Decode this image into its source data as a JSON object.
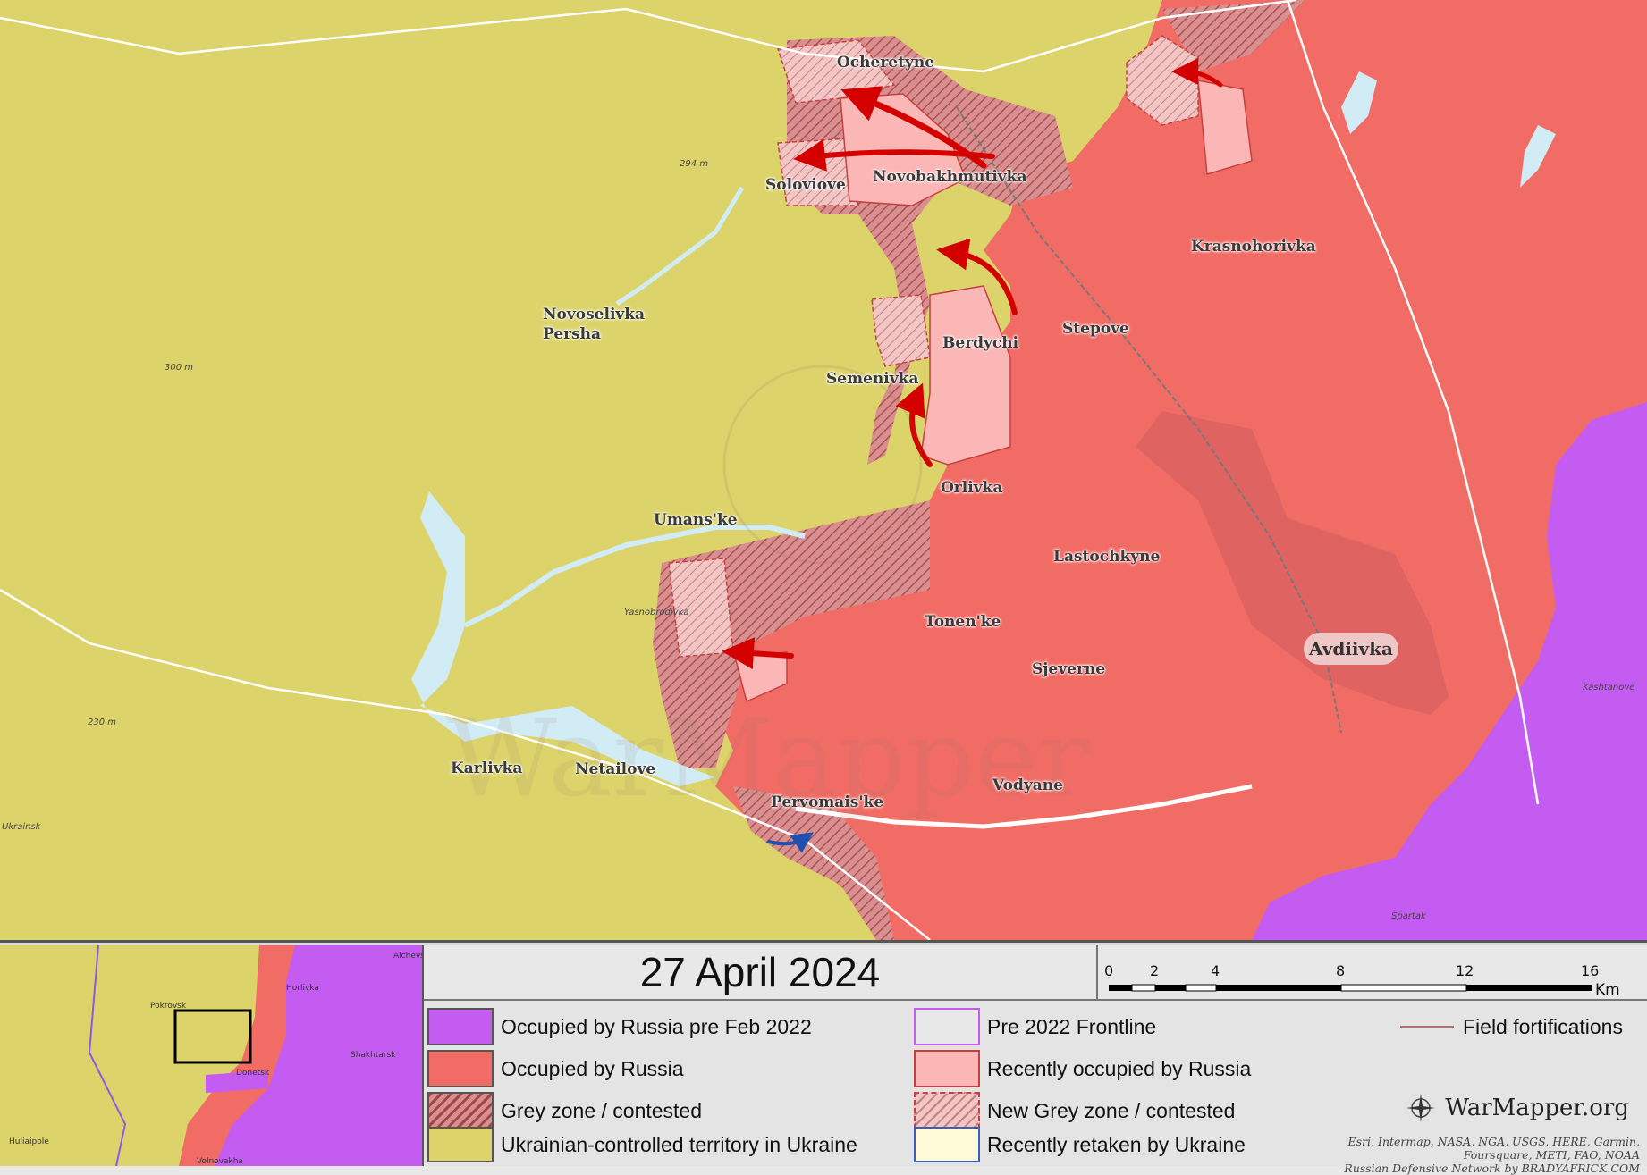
{
  "date": "27 April 2024",
  "scale_bar": {
    "ticks": [
      "0",
      "2",
      "4",
      "8",
      "12",
      "16"
    ],
    "unit": "Km"
  },
  "legend": {
    "occupied_pre2022": "Occupied by Russia pre Feb 2022",
    "occupied": "Occupied by Russia",
    "grey_zone": "Grey zone / contested",
    "ukrainian": "Ukrainian-controlled territory in Ukraine",
    "pre2022_frontline": "Pre 2022 Frontline",
    "recently_occupied": "Recently occupied by Russia",
    "new_grey_zone": "New Grey zone / contested",
    "recently_retaken": "Recently retaken by Ukraine",
    "field_fortifications": "Field fortifications"
  },
  "colors": {
    "ukrainian": "#dcd46b",
    "occupied": "#f26c66",
    "occupied_pre2022": "#c45cf2",
    "recently_occupied": "#fbb6b6",
    "grey_zone": "#c97b7b",
    "water": "#d2ecf6",
    "arrow": "#d40000",
    "ua_arrow": "#1f4fb0"
  },
  "brand": "WarMapper.org",
  "credits": [
    "Esri, Intermap, NASA, NGA, USGS, HERE, Garmin,",
    "Foursquare, METI, FAO, NOAA",
    "Russian Defensive Network by BRADYAFRICK.COM"
  ],
  "places": {
    "ocheretyne": "Ocheretyne",
    "soloviove": "Soloviove",
    "novobakhmutivka": "Novobakhmutivka",
    "krasnohorivka": "Krasnohorivka",
    "novoselivka": "Novoselivka",
    "persha": "Persha",
    "berdychi": "Berdychi",
    "stepove": "Stepove",
    "semenivka": "Semenivka",
    "orlivka": "Orlivka",
    "umanske": "Umans'ke",
    "lastochkyne": "Lastochkyne",
    "tonenke": "Tonen'ke",
    "sjeverne": "Sjeverne",
    "avdiivka": "Avdiivka",
    "karlivka": "Karlivka",
    "netailove": "Netailove",
    "pervomaiske": "Pervomais'ke",
    "vodyane": "Vodyane"
  },
  "small_places": {
    "yasnobrodivka": "Yasnobrodivka",
    "kashtanove": "Kashtanove",
    "ukrainsk": "Ukrainsk",
    "spartak": "Spartak",
    "h294": "294 m",
    "h300": "300 m",
    "h230": "230 m"
  },
  "inset_labels": {
    "pokrovsk": "Pokrovsk",
    "horlivka": "Horlivka",
    "shakhtarsk": "Shakhtarsk",
    "donetsk": "Donetsk",
    "huliaipole": "Huliaipole",
    "volnovakha": "Volnovakha",
    "alchevsk": "Alchevsk"
  },
  "watermark": "WarMapper"
}
